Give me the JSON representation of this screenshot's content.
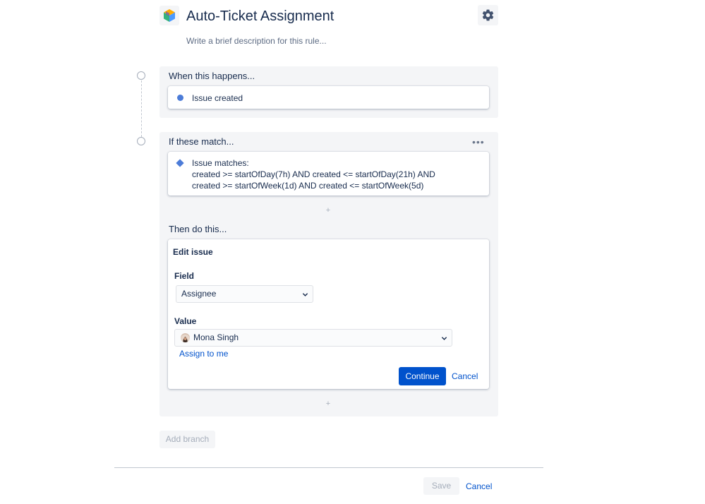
{
  "header": {
    "title": "Auto-Ticket Assignment",
    "description_placeholder": "Write a brief description for this rule...",
    "logo_icon": "automation-cube-icon",
    "settings_icon": "gear-icon"
  },
  "trigger": {
    "heading": "When this happens...",
    "item_label": "Issue created",
    "item_color": "#4c7cd8"
  },
  "condition": {
    "heading": "If these match...",
    "menu_icon": "more-horizontal-icon",
    "lines": [
      "Issue matches:",
      "created >= startOfDay(7h) AND created <= startOfDay(21h) AND",
      "created >= startOfWeek(1d) AND created <= startOfWeek(5d)"
    ]
  },
  "action": {
    "heading": "Then do this...",
    "card_title": "Edit issue",
    "field_label": "Field",
    "field_value": "Assignee",
    "value_label": "Value",
    "value_user": "Mona Singh",
    "assign_to_me": "Assign to me",
    "continue_label": "Continue",
    "cancel_label": "Cancel"
  },
  "add_symbol": "+",
  "add_branch_label": "Add branch",
  "footer": {
    "save_label": "Save",
    "cancel_label": "Cancel"
  },
  "colors": {
    "primary": "#0052cc",
    "panel_bg": "#f4f5f7",
    "text": "#172b4d",
    "subtle_text": "#5e6c84"
  }
}
